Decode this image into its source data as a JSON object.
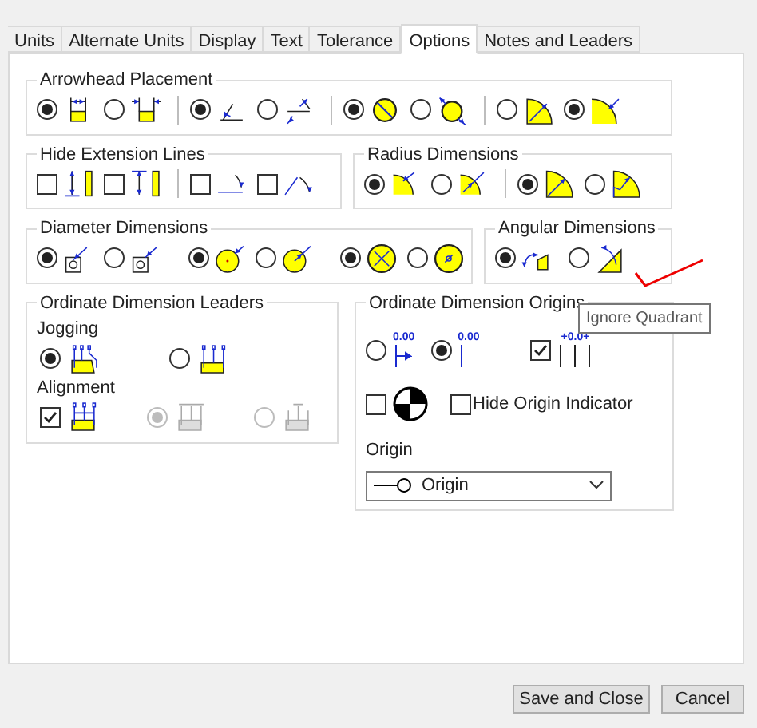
{
  "tabs": [
    {
      "label": "Units",
      "selected": false
    },
    {
      "label": "Alternate Units",
      "selected": false
    },
    {
      "label": "Display",
      "selected": false
    },
    {
      "label": "Text",
      "selected": false
    },
    {
      "label": "Tolerance",
      "selected": false
    },
    {
      "label": "Options",
      "selected": true
    },
    {
      "label": "Notes and Leaders",
      "selected": false
    }
  ],
  "arrowhead_placement": {
    "title": "Arrowhead Placement",
    "groups": [
      [
        {
          "selected": true
        },
        {
          "selected": false
        }
      ],
      [
        {
          "selected": true
        },
        {
          "selected": false
        }
      ],
      [
        {
          "selected": true
        },
        {
          "selected": false
        }
      ],
      [
        {
          "selected": false
        },
        {
          "selected": true
        }
      ]
    ]
  },
  "hide_extension_lines": {
    "title": "Hide Extension Lines",
    "groups": [
      [
        {
          "checked": false
        },
        {
          "checked": false
        }
      ],
      [
        {
          "checked": false
        },
        {
          "checked": false
        }
      ]
    ]
  },
  "radius_dimensions": {
    "title": "Radius Dimensions",
    "groups": [
      [
        {
          "selected": true
        },
        {
          "selected": false
        }
      ],
      [
        {
          "selected": true
        },
        {
          "selected": false
        }
      ]
    ]
  },
  "diameter_dimensions": {
    "title": "Diameter Dimensions",
    "groups": [
      [
        {
          "selected": true
        },
        {
          "selected": false
        }
      ],
      [
        {
          "selected": true
        },
        {
          "selected": false
        }
      ],
      [
        {
          "selected": true
        },
        {
          "selected": false
        }
      ]
    ]
  },
  "angular_dimensions": {
    "title": "Angular Dimensions",
    "options": [
      {
        "selected": true
      },
      {
        "selected": false
      }
    ]
  },
  "ordinate_dimension_leaders": {
    "title": "Ordinate Dimension Leaders",
    "jogging": {
      "label": "Jogging",
      "options": [
        {
          "selected": true
        },
        {
          "selected": false
        }
      ]
    },
    "alignment": {
      "label": "Alignment",
      "checked": true,
      "options": [
        {
          "selected": true,
          "disabled": true
        },
        {
          "selected": false,
          "disabled": true
        }
      ]
    }
  },
  "ordinate_dimension_origins": {
    "title": "Ordinate Dimension Origins",
    "options": [
      {
        "selected": false,
        "icon_text": "0.00"
      },
      {
        "selected": true,
        "icon_text": "0.00"
      }
    ],
    "spacing": {
      "checked": true,
      "icon_text": "+0.0+"
    },
    "origin_symbol": {
      "checked": false
    },
    "hide_origin_indicator": {
      "label": "Hide Origin Indicator",
      "checked": false
    },
    "origin": {
      "label": "Origin",
      "value": "Origin"
    }
  },
  "tooltip": "Ignore Quadrant",
  "buttons": [
    "Save and Close",
    "Cancel"
  ]
}
